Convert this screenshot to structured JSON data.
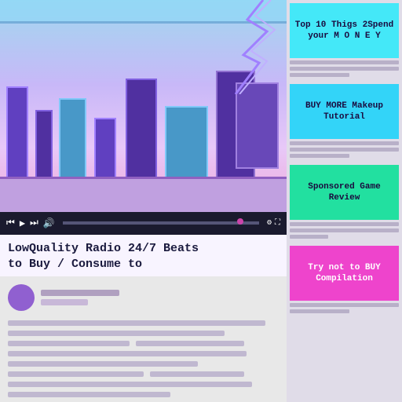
{
  "player": {
    "title_line1": "LowQuality Radio 24/7 Beats",
    "title_line2": "to Buy / Consume to",
    "controls": {
      "play": "▶",
      "prev": "⏮",
      "next": "⏭",
      "volume": "🔊"
    }
  },
  "sidebar": {
    "cards": [
      {
        "id": "card-1",
        "label": "Top 10 Thigs 2Spend your M O N E Y",
        "color_class": "thumb-cyan",
        "interactable": true
      },
      {
        "id": "card-2",
        "label": "BUY MORE Makeup Tutorial",
        "color_class": "thumb-cyan2",
        "interactable": true
      },
      {
        "id": "card-3",
        "label": "Sponsored Game Review",
        "color_class": "thumb-green",
        "interactable": true
      },
      {
        "id": "card-4",
        "label": "Try not to BUY Compilation",
        "color_class": "thumb-pink",
        "interactable": true
      }
    ]
  }
}
